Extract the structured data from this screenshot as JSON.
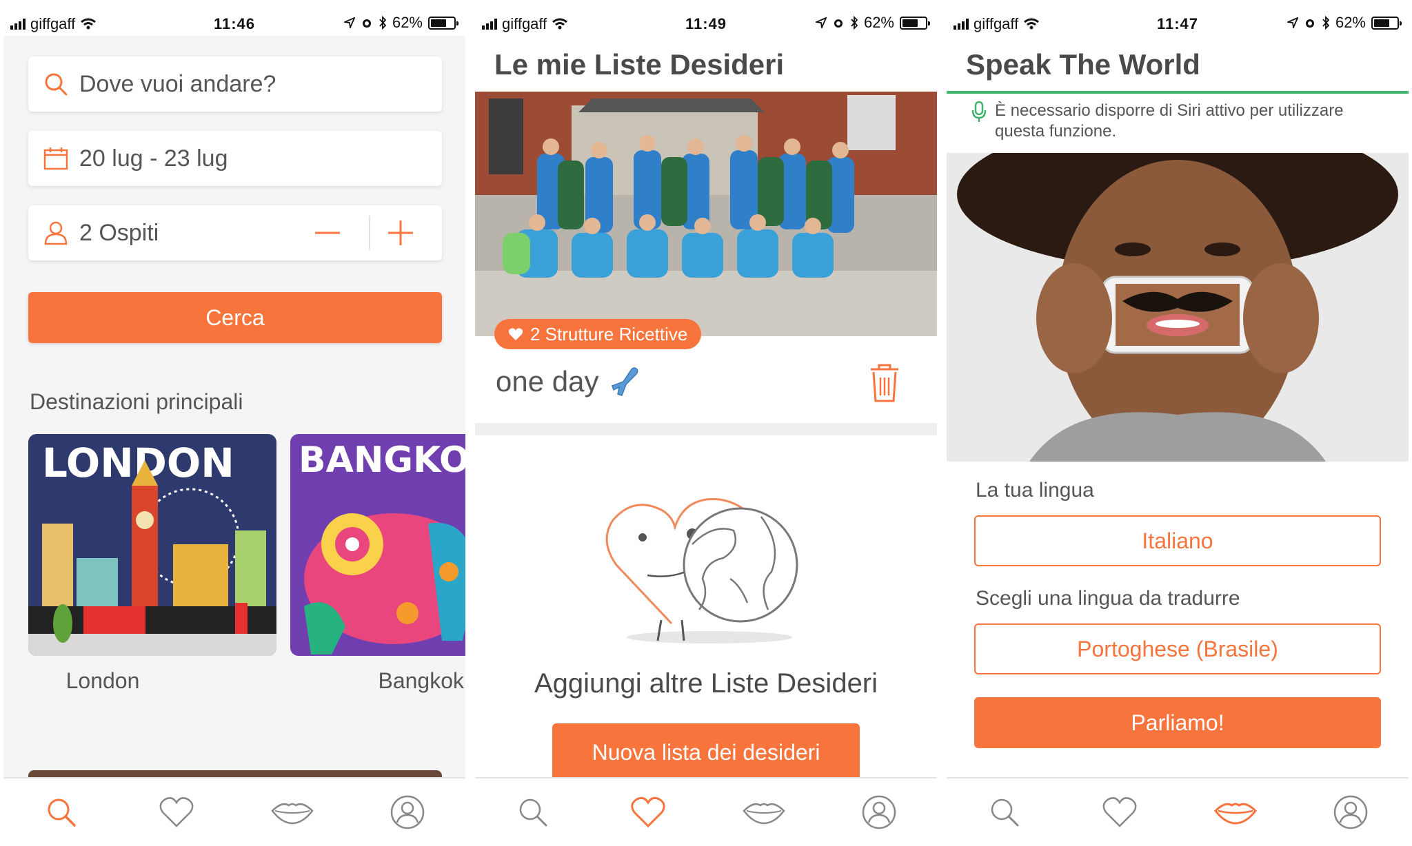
{
  "colors": {
    "accent": "#f7743d",
    "siri_green": "#3fb36b",
    "text": "#555555"
  },
  "screens": [
    {
      "status": {
        "carrier": "giffgaff",
        "time": "11:46",
        "battery": "62%"
      },
      "search": {
        "destination_placeholder": "Dove vuoi andare?",
        "dates": "20 lug - 23 lug",
        "guests": "2 Ospiti",
        "button": "Cerca"
      },
      "destinations": {
        "title": "Destinazioni principali",
        "items": [
          {
            "label": "London",
            "poster_text": "LONDON"
          },
          {
            "label": "Bangkok",
            "poster_text": "BANGKO"
          }
        ]
      },
      "tabs": [
        {
          "icon": "search-icon",
          "active": true
        },
        {
          "icon": "heart-icon",
          "active": false
        },
        {
          "icon": "lips-icon",
          "active": false
        },
        {
          "icon": "profile-icon",
          "active": false
        }
      ]
    },
    {
      "status": {
        "carrier": "giffgaff",
        "time": "11:49",
        "battery": "62%"
      },
      "title": "Le mie Liste Desideri",
      "wishlist": {
        "badge": "2 Strutture Ricettive",
        "name": "one day"
      },
      "empty": {
        "title": "Aggiungi altre Liste Desideri",
        "button": "Nuova lista dei desideri"
      },
      "tabs": [
        {
          "icon": "search-icon",
          "active": false
        },
        {
          "icon": "heart-icon",
          "active": true
        },
        {
          "icon": "lips-icon",
          "active": false
        },
        {
          "icon": "profile-icon",
          "active": false
        }
      ]
    },
    {
      "status": {
        "carrier": "giffgaff",
        "time": "11:47",
        "battery": "62%"
      },
      "title": "Speak The World",
      "siri_note": "È necessario disporre di Siri attivo per utilizzare questa funzione.",
      "your_language": {
        "label": "La tua lingua",
        "value": "Italiano"
      },
      "target_language": {
        "label": "Scegli una lingua da tradurre",
        "value": "Portoghese (Brasile)"
      },
      "button": "Parliamo!",
      "tabs": [
        {
          "icon": "search-icon",
          "active": false
        },
        {
          "icon": "heart-icon",
          "active": false
        },
        {
          "icon": "lips-icon",
          "active": true
        },
        {
          "icon": "profile-icon",
          "active": false
        }
      ]
    }
  ]
}
